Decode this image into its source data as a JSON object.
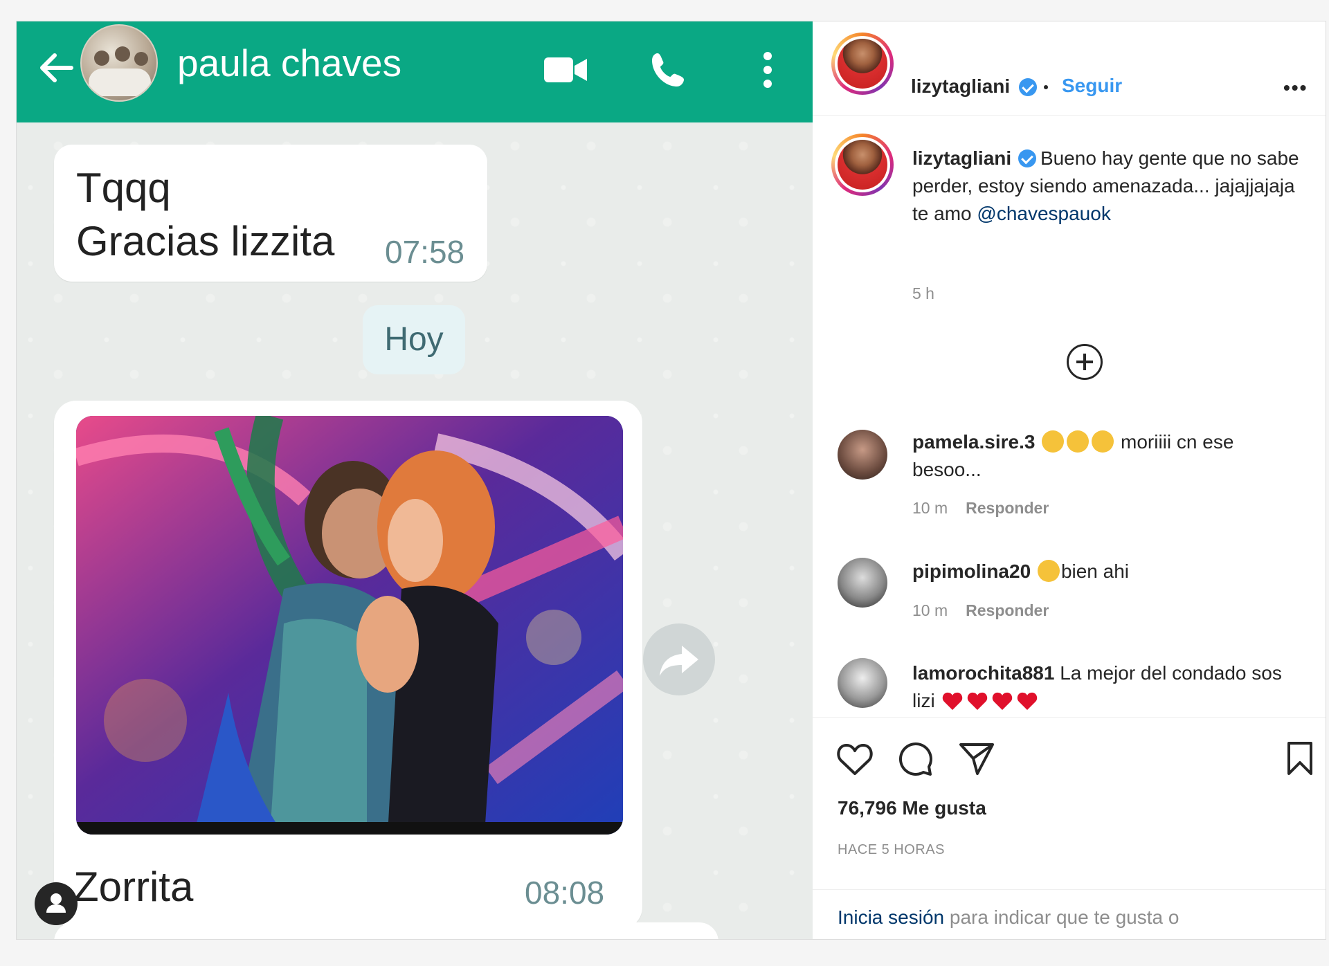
{
  "whatsapp": {
    "contact_name": "paula chaves",
    "messages": [
      {
        "line1": "Tqqq",
        "line2": "Gracias lizzita",
        "time": "07:58"
      }
    ],
    "day_divider": "Hoy",
    "image_message": {
      "caption": "Zorrita",
      "time": "08:08"
    },
    "colors": {
      "header": "#0aa884",
      "chat_bg": "#e9ecea",
      "time_text": "#6b8e92"
    }
  },
  "instagram": {
    "header": {
      "username": "lizytagliani",
      "follow_label": "Seguir",
      "more_label": "•••"
    },
    "caption": {
      "username": "lizytagliani",
      "text": "Bueno hay gente que no sabe perder, estoy siendo amenazada... jajajjajaja te amo",
      "mention": "@chavespauok",
      "time": "5 h"
    },
    "comments": [
      {
        "username": "pamela.sire.3",
        "text_after": "moriiii cn ese besoo...",
        "time": "10 m",
        "reply": "Responder"
      },
      {
        "username": "pipimolina20",
        "text_after": "bien ahi",
        "time": "10 m",
        "reply": "Responder"
      },
      {
        "username": "lamorochita881",
        "text_after": "La mejor del condado sos lizi"
      }
    ],
    "likes": "76,796 Me gusta",
    "posted_ago": "HACE 5 HORAS",
    "login": {
      "link": "Inicia sesión",
      "rest": "para indicar que te gusta o comentar."
    },
    "colors": {
      "link": "#3897f0",
      "mention": "#00376b",
      "muted": "#8e8e8e"
    }
  }
}
